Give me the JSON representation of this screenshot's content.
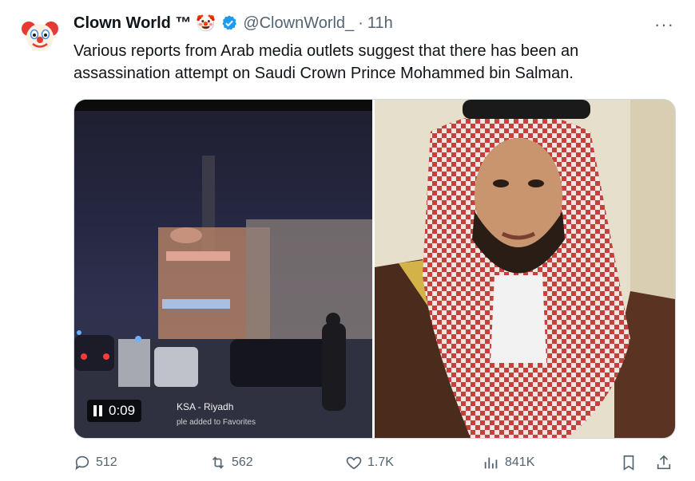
{
  "author": {
    "display_name": "Clown World ™",
    "name_emoji": "🤡",
    "handle": "@ClownWorld_",
    "separator": "·",
    "time": "11h",
    "avatar_icon": "clown-face-icon",
    "verified_icon": "verified-badge-icon",
    "verified_color": "#1d9bf0"
  },
  "more_label": "···",
  "tweet": {
    "text": "Various reports from Arab media outlets suggest that there has been an assassination attempt on Saudi Crown Prince Mohammed bin Salman."
  },
  "media": {
    "video": {
      "time": "0:09",
      "location_caption": "KSA - Riyadh",
      "favorites_caption": "ple added to Favorites"
    },
    "photo": {
      "icon": "portrait-photo-icon"
    }
  },
  "actions": {
    "reply": {
      "icon": "reply-icon",
      "count": "512"
    },
    "repost": {
      "icon": "repost-icon",
      "count": "562"
    },
    "like": {
      "icon": "heart-icon",
      "count": "1.7K"
    },
    "views": {
      "icon": "views-icon",
      "count": "841K"
    },
    "bookmark": {
      "icon": "bookmark-icon"
    },
    "share": {
      "icon": "share-icon"
    }
  },
  "colors": {
    "text": "#0f1419",
    "secondary": "#536471",
    "accent": "#1d9bf0"
  }
}
